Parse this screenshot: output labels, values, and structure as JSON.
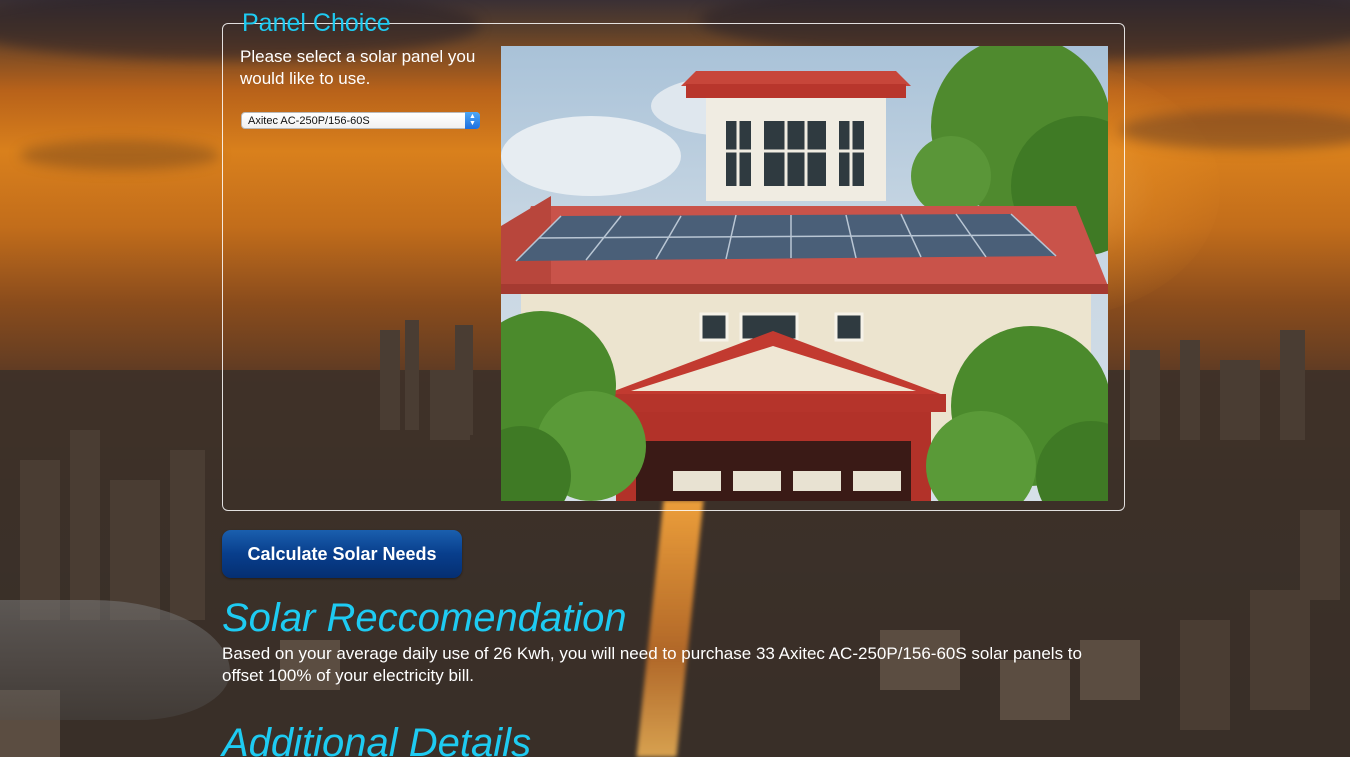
{
  "panel_choice": {
    "legend": "Panel Choice",
    "prompt": "Please select a solar panel you would like to use.",
    "select": {
      "selected_value": "Axitec AC-250P/156-60S"
    },
    "photo": {
      "icon": "house-with-solar-panels-image"
    }
  },
  "actions": {
    "calculate_label": "Calculate Solar Needs"
  },
  "recommendation": {
    "title": "Solar Reccomendation",
    "text": "Based on your average daily use of 26 Kwh, you will need to purchase 33 Axitec AC-250P/156-60S solar panels to offset 100% of your electricity bill."
  },
  "additional": {
    "title": "Additional Details"
  },
  "colors": {
    "accent": "#1ecbf2",
    "button": "#083e8c",
    "text": "#ffffff"
  }
}
